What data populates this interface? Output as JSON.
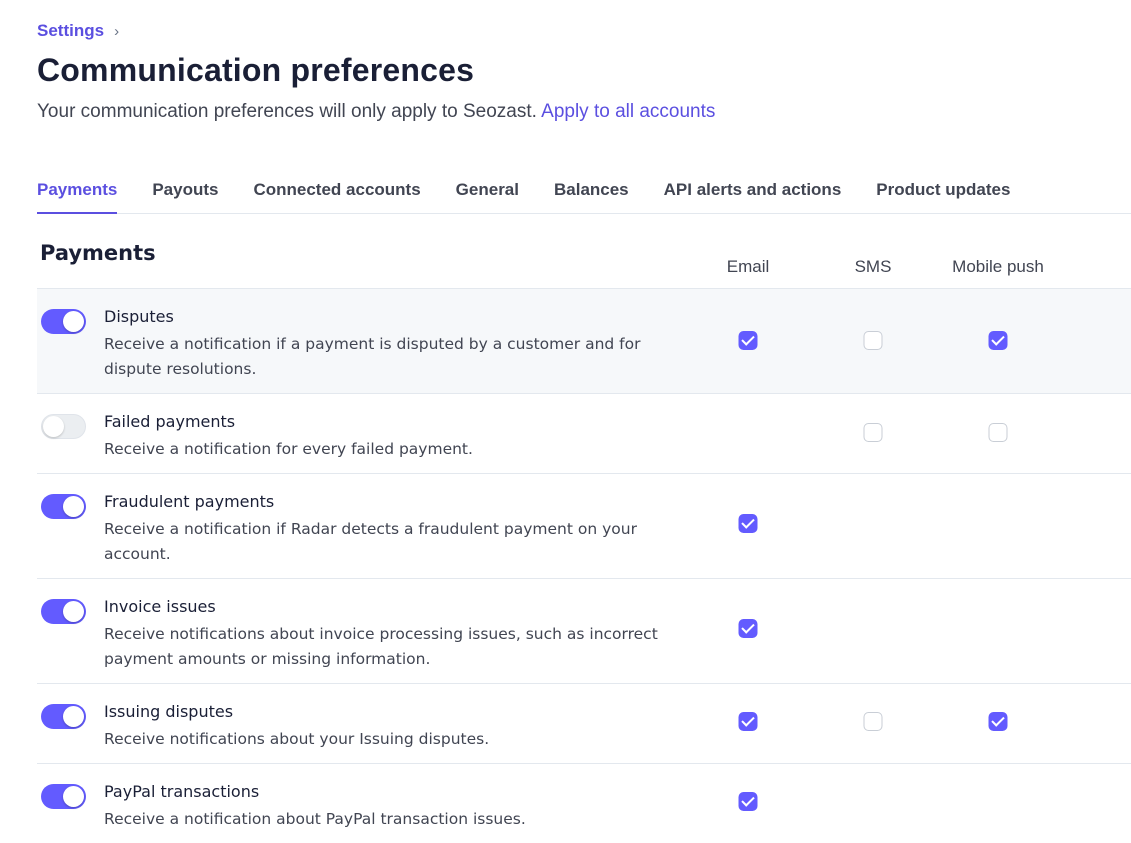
{
  "breadcrumb": {
    "parent": "Settings",
    "separator": "›"
  },
  "header": {
    "title": "Communication preferences",
    "subtitle": "Your communication preferences will only apply to Seozast.",
    "apply_link": "Apply to all accounts"
  },
  "tabs": [
    {
      "label": "Payments",
      "active": true
    },
    {
      "label": "Payouts"
    },
    {
      "label": "Connected accounts"
    },
    {
      "label": "General"
    },
    {
      "label": "Balances"
    },
    {
      "label": "API alerts and actions"
    },
    {
      "label": "Product updates"
    }
  ],
  "section": {
    "title": "Payments",
    "columns": [
      "Email",
      "SMS",
      "Mobile push"
    ]
  },
  "rows": [
    {
      "title": "Disputes",
      "description": "Receive a notification if a payment is disputed by a customer and for dispute resolutions.",
      "enabled": true,
      "email": true,
      "sms": false,
      "push": true
    },
    {
      "title": "Failed payments",
      "description": "Receive a notification for every failed payment.",
      "enabled": false,
      "email": null,
      "sms": false,
      "push": false
    },
    {
      "title": "Fraudulent payments",
      "description": "Receive a notification if Radar detects a fraudulent payment on your account.",
      "enabled": true,
      "email": true,
      "sms": null,
      "push": null
    },
    {
      "title": "Invoice issues",
      "description": "Receive notifications about invoice processing issues, such as incorrect payment amounts or missing information.",
      "enabled": true,
      "email": true,
      "sms": null,
      "push": null
    },
    {
      "title": "Issuing disputes",
      "description": "Receive notifications about your Issuing disputes.",
      "enabled": true,
      "email": true,
      "sms": false,
      "push": true
    },
    {
      "title": "PayPal transactions",
      "description": "Receive a notification about PayPal transaction issues.",
      "enabled": true,
      "email": true,
      "sms": null,
      "push": null
    }
  ],
  "colors": {
    "accent": "#635bff",
    "link": "#5b4fe0",
    "text": "#1a1f36",
    "muted": "#414552",
    "row_highlight": "#f6f8fa"
  },
  "icons": {
    "breadcrumb_separator": "chevron-right-icon",
    "checkbox_checked": "check-icon"
  }
}
